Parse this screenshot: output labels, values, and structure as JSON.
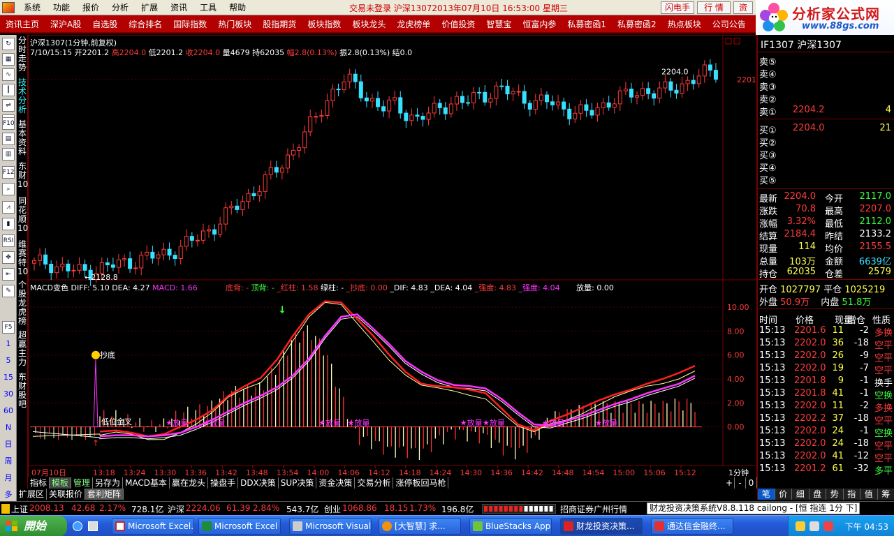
{
  "menu": [
    "系统",
    "功能",
    "报价",
    "分析",
    "扩展",
    "资讯",
    "工具",
    "帮助"
  ],
  "title_status": "交易未登录   沪深13072013年07月10日  16:53:00  星期三",
  "top_buttons": [
    "闪电手",
    "行  情",
    "资"
  ],
  "brand": {
    "name": "分析家公式网",
    "url": "www.88gs.com"
  },
  "redbar": [
    "资讯主页",
    "深沪A股",
    "自选股",
    "综合排名",
    "国际指数",
    "热门板块",
    "股指期货",
    "板块指数",
    "板块龙头",
    "龙虎榜单",
    "价值投资",
    "智慧宝",
    "恒富内参",
    "私募密函1",
    "私募密函2",
    "热点板块",
    "公司公告",
    "金"
  ],
  "vtabs": [
    "分时走势",
    "技术分析",
    "基本资料",
    "东财10",
    "同花顺10",
    "维赛特10",
    "个股龙虎榜",
    "超赢主力",
    "东财股吧"
  ],
  "left_icons": [
    "5",
    "15",
    "30",
    "60",
    "N",
    "日",
    "周",
    "月",
    "多"
  ],
  "chart_header": {
    "line1": "沪深1307(1分钟,前复权)",
    "date": "7/10/15:15",
    "open_label": "开",
    "open": "2201.2",
    "high_label": "高",
    "high": "2204.0",
    "low_label": "低",
    "low": "2201.2",
    "close_label": "收",
    "close": "2204.0",
    "vol_label": "量",
    "vol": "4679",
    "oi_label": "持",
    "oi": "62035",
    "chg_label": "幅",
    "chg": "2.8(0.13%)",
    "amp_label": "振",
    "amp": "2.8(0.13%)",
    "settle_label": "结",
    "settle": "0.0"
  },
  "macd_header": {
    "name": "MACD变色",
    "diff": "DIFF: 5.10",
    "dea": "DEA: 4.27",
    "macd": "MACD: 1.66",
    "dibei": "底背: -",
    "dingbei": "顶背: -",
    "hongzhu": "_红柱: 1.58",
    "lvzhu": "绿柱: -",
    "chaodi": "_抄底: 0.00",
    "dif": "_DIF: 4.83",
    "dea2": "_DEA: 4.04",
    "qiangdu1": "_强度: 4.83",
    "qiangdu2": "_强度: 4.04",
    "fangliang": "放量: 0.00"
  },
  "price_axis": {
    "label": "2201",
    "peak_label": "2204.0",
    "low_label": "←2128.8"
  },
  "macd_axis": [
    "10.00",
    "8.00",
    "6.00",
    "4.00",
    "2.00",
    "0.00"
  ],
  "time_axis": [
    "07月10日",
    "13:18",
    "13:24",
    "13:30",
    "13:36",
    "13:42",
    "13:48",
    "13:54",
    "14:00",
    "14:06",
    "14:12",
    "14:18",
    "14:24",
    "14:30",
    "14:36",
    "14:42",
    "14:48",
    "14:54",
    "15:00",
    "15:06",
    "15:12"
  ],
  "period_label": "1分钟",
  "annotations": {
    "chaodi": "抄底",
    "dixi": "低位金叉",
    "fangliang": "放量"
  },
  "bottom_tabs1": [
    "指标",
    "模板",
    "管理",
    "另存为",
    "MACD基本",
    "赢在龙头",
    "操盘手",
    "DDX决策",
    "SUP决策",
    "资金决策",
    "交易分析",
    "涨停板回马枪"
  ],
  "bottom_tabs1_controls": [
    "+",
    "-",
    "0"
  ],
  "bottom_tabs2": [
    "扩展区",
    "关联报价",
    "套利矩阵"
  ],
  "right": {
    "title": "IF1307 沪深1307",
    "sells": [
      {
        "label": "卖⑤",
        "price": "",
        "vol": ""
      },
      {
        "label": "卖④",
        "price": "",
        "vol": ""
      },
      {
        "label": "卖③",
        "price": "",
        "vol": ""
      },
      {
        "label": "卖②",
        "price": "",
        "vol": ""
      },
      {
        "label": "卖①",
        "price": "2204.2",
        "vol": "4"
      }
    ],
    "buys": [
      {
        "label": "买①",
        "price": "2204.0",
        "vol": "21"
      },
      {
        "label": "买②",
        "price": "",
        "vol": ""
      },
      {
        "label": "买③",
        "price": "",
        "vol": ""
      },
      {
        "label": "买④",
        "price": "",
        "vol": ""
      },
      {
        "label": "买⑤",
        "price": "",
        "vol": ""
      }
    ],
    "stats": [
      {
        "l1": "最新",
        "v1": "2204.0",
        "c1": "r",
        "l2": "今开",
        "v2": "2117.0",
        "c2": "g"
      },
      {
        "l1": "涨跌",
        "v1": "70.8",
        "c1": "r",
        "l2": "最高",
        "v2": "2207.0",
        "c2": "r"
      },
      {
        "l1": "涨幅",
        "v1": "3.32%",
        "c1": "r",
        "l2": "最低",
        "v2": "2112.0",
        "c2": "g"
      },
      {
        "l1": "结算",
        "v1": "2184.4",
        "c1": "r",
        "l2": "昨结",
        "v2": "2133.2",
        "c2": "w"
      },
      {
        "l1": "现量",
        "v1": "114",
        "c1": "y",
        "l2": "均价",
        "v2": "2155.5",
        "c2": "r"
      },
      {
        "l1": "总量",
        "v1": "103万",
        "c1": "y",
        "l2": "金额",
        "v2": "6639亿",
        "c2": "c"
      },
      {
        "l1": "持仓",
        "v1": "62035",
        "c1": "y",
        "l2": "仓差",
        "v2": "2579",
        "c2": "y"
      }
    ],
    "kai": {
      "l1": "开仓",
      "v1": "1027797",
      "l2": "平仓",
      "v2": "1025219"
    },
    "wai": {
      "l1": "外盘",
      "v1": "50.9万",
      "l2": "内盘",
      "v2": "51.8万"
    },
    "trade_header": [
      "时间",
      "价格",
      "现量",
      "增仓",
      "性质"
    ],
    "trades": [
      {
        "t": "15:13",
        "p": "2201.6",
        "v": "11",
        "z": "-2",
        "n": "多换",
        "c": "r"
      },
      {
        "t": "15:13",
        "p": "2202.0",
        "v": "36",
        "z": "-18",
        "n": "空平",
        "c": "r"
      },
      {
        "t": "15:13",
        "p": "2202.0",
        "v": "26",
        "z": "-9",
        "n": "空平",
        "c": "r"
      },
      {
        "t": "15:13",
        "p": "2202.0",
        "v": "19",
        "z": "-7",
        "n": "空平",
        "c": "r"
      },
      {
        "t": "15:13",
        "p": "2201.8",
        "v": "9",
        "z": "-1",
        "n": "换手",
        "c": "w"
      },
      {
        "t": "15:13",
        "p": "2201.8",
        "v": "41",
        "z": "-1",
        "n": "空换",
        "c": "g"
      },
      {
        "t": "15:13",
        "p": "2202.0",
        "v": "11",
        "z": "-2",
        "n": "多换",
        "c": "r"
      },
      {
        "t": "15:13",
        "p": "2202.2",
        "v": "37",
        "z": "-18",
        "n": "空平",
        "c": "r"
      },
      {
        "t": "15:13",
        "p": "2202.0",
        "v": "24",
        "z": "-1",
        "n": "空换",
        "c": "g"
      },
      {
        "t": "15:13",
        "p": "2202.0",
        "v": "24",
        "z": "-18",
        "n": "空平",
        "c": "r"
      },
      {
        "t": "15:13",
        "p": "2202.0",
        "v": "41",
        "z": "-12",
        "n": "空平",
        "c": "r"
      },
      {
        "t": "15:13",
        "p": "2201.2",
        "v": "61",
        "z": "-32",
        "n": "多平",
        "c": "g"
      }
    ],
    "tabs": [
      "笔",
      "价",
      "细",
      "盘",
      "势",
      "指",
      "值",
      "筹"
    ]
  },
  "ticker": {
    "sh_label": "上证",
    "sh_val": "2008.13",
    "sh_chg": "42.68",
    "sh_pct": "2.17%",
    "sh_amt": "728.1亿",
    "hs_label": "沪深",
    "hs_val": "2224.06",
    "hs_chg": "61.39",
    "hs_pct": "2.84%",
    "hs_amt": "543.7亿",
    "cy_label": "创业",
    "cy_val": "1068.86",
    "cy_chg": "18.15",
    "cy_pct": "1.73%",
    "cy_amt": "196.8亿",
    "broker": "招商证券广州行情",
    "system": "财龙投资决策系统V8.8.118 cailong - [恒 指连 1分 下]"
  },
  "taskbar": {
    "start": "開始",
    "tasks": [
      "Microsoft Excel...",
      "Microsoft Excel ...",
      "Microsoft Visual...",
      "[大智慧] 求...",
      "BlueStacks App ...",
      "财龙投资决策...",
      "通达信金融终..."
    ],
    "clock": "下午 04:53"
  },
  "colors": {
    "up": "#ff3b3b",
    "down": "#38e0ff",
    "macd_red": "#ff2020",
    "macd_pink": "#ff33ff",
    "signal_yellow": "#ffffb0",
    "frame": "#7a0000"
  },
  "chart_data": {
    "type": "candlestick",
    "title": "沪深1307(1分钟,前复权)",
    "x_range": [
      "13:12",
      "15:15"
    ],
    "price_range": [
      2128.8,
      2207.0
    ],
    "price_series_close": [
      2132,
      2133,
      2131,
      2130,
      2129,
      2130,
      2131,
      2132,
      2133,
      2134,
      2135,
      2136,
      2138,
      2140,
      2143,
      2146,
      2150,
      2154,
      2158,
      2162,
      2166,
      2171,
      2177,
      2183,
      2190,
      2197,
      2201,
      2198,
      2194,
      2190,
      2192,
      2189,
      2186,
      2188,
      2191,
      2193,
      2192,
      2195,
      2196,
      2197,
      2196,
      2194,
      2192,
      2193,
      2191,
      2189,
      2188,
      2190,
      2193,
      2194,
      2196,
      2197,
      2196,
      2197,
      2199,
      2201,
      2203,
      2204
    ],
    "macd": {
      "axis_range": [
        -3,
        11
      ],
      "diff": [
        -0.4,
        -0.3,
        -0.5,
        -0.8,
        -0.6,
        0.0,
        0.6,
        1.4,
        2.6,
        3.4,
        4.1,
        5.6,
        7.6,
        9.4,
        10.5,
        10.4,
        9.0,
        7.6,
        6.0,
        4.6,
        3.6,
        3.4,
        3.3,
        3.1,
        2.8,
        1.5,
        0.2,
        -0.3,
        0.5,
        1.0,
        1.6,
        2.2,
        2.7,
        3.1,
        3.6,
        4.0,
        4.5,
        5.1
      ],
      "dea": [
        -0.8,
        -0.7,
        -0.7,
        -0.8,
        -0.7,
        -0.5,
        0.0,
        0.6,
        1.3,
        2.0,
        2.6,
        3.3,
        4.3,
        5.7,
        7.6,
        9.2,
        9.4,
        8.2,
        6.9,
        5.5,
        4.6,
        3.9,
        3.5,
        3.4,
        3.2,
        2.3,
        1.2,
        0.2,
        0.1,
        0.5,
        0.9,
        1.4,
        1.9,
        2.3,
        2.8,
        3.2,
        3.6,
        4.27
      ]
    }
  }
}
